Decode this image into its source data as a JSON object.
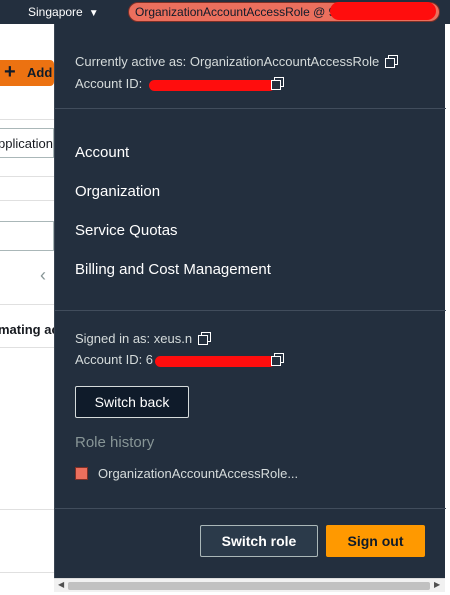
{
  "topbar": {
    "region": "Singapore",
    "role_label": "OrganizationAccountAccessRole @ 9"
  },
  "background": {
    "add_label": "Add",
    "field_text": "pplication",
    "column_text": "mating ac"
  },
  "panel": {
    "active_label": "Currently active as: OrganizationAccountAccessRole",
    "account_id_label": "Account ID: ",
    "menu": [
      "Account",
      "Organization",
      "Service Quotas",
      "Billing and Cost Management"
    ],
    "signed_in_label": "Signed in as: xeus.n",
    "signed_account_id_label": "Account ID: 6",
    "switch_back_label": "Switch back",
    "role_history_label": "Role history",
    "role_history_items": [
      "OrganizationAccountAccessRole..."
    ],
    "switch_role_label": "Switch role",
    "sign_out_label": "Sign out"
  },
  "colors": {
    "nav_bg": "#232f3e",
    "role_pill": "#eb6f5d",
    "accent_orange": "#ff9900",
    "redaction": "#ff0d0d"
  },
  "icons": [
    "caret-down-icon",
    "copy-icon",
    "plus-icon",
    "chevron-left-icon"
  ]
}
